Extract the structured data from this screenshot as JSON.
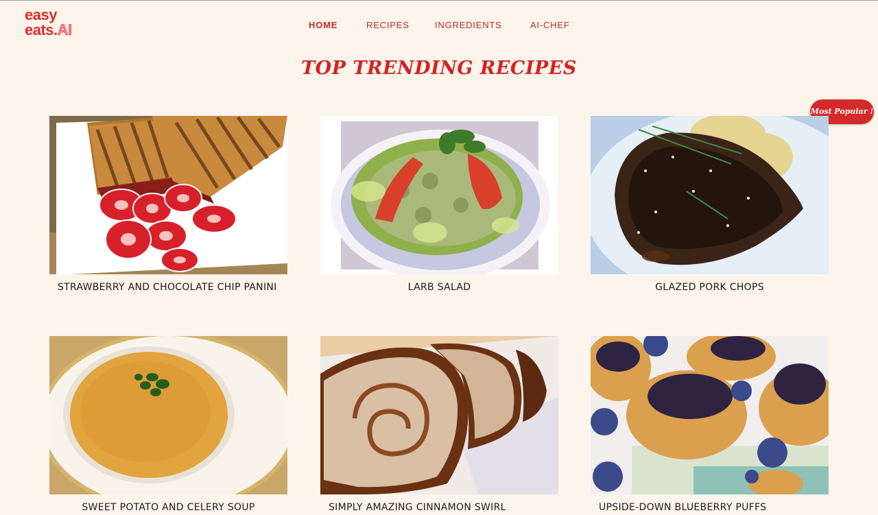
{
  "brand": {
    "line1": "easy",
    "line2": "eats.",
    "line2_accent": "AI"
  },
  "nav": {
    "items": [
      {
        "label": "HOME",
        "active": true
      },
      {
        "label": "RECIPES",
        "active": false
      },
      {
        "label": "INGREDIENTS",
        "active": false
      },
      {
        "label": "AI-CHEF",
        "active": false
      }
    ]
  },
  "page_title": "TOP TRENDING RECIPES",
  "badge": "Most Popular !",
  "recipes": [
    {
      "name": "STRAWBERRY AND CHOCOLATE CHIP PANINI"
    },
    {
      "name": "LARB SALAD"
    },
    {
      "name": "GLAZED PORK CHOPS"
    },
    {
      "name": "SWEET POTATO AND CELERY SOUP"
    },
    {
      "name": "SIMPLY AMAZING CINNAMON SWIRL"
    },
    {
      "name": "UPSIDE-DOWN BLUEBERRY PUFFS"
    }
  ],
  "colors": {
    "accent": "#d42323",
    "background": "#fdf5ec",
    "badge": "#d42a2a"
  }
}
